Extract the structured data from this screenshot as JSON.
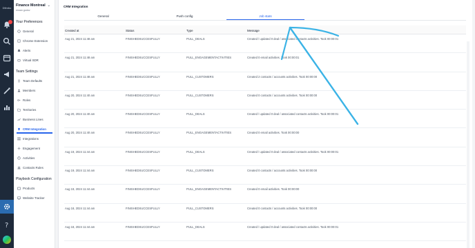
{
  "rail": {
    "logo": "Dfimbo",
    "icons": [
      "bell-icon",
      "search-icon",
      "calendar-icon",
      "megaphone-icon",
      "wand-icon",
      "chart-icon",
      "gear-icon",
      "help-icon"
    ]
  },
  "sidebar": {
    "company": "Finance Montreal",
    "user": "erwan godov",
    "preferences_title": "Your Preferences",
    "preferences": [
      {
        "label": "General",
        "icon": "gear-icon"
      },
      {
        "label": "Chrome Extension",
        "icon": "puzzle-icon"
      },
      {
        "label": "Alerts",
        "icon": "bell-icon"
      },
      {
        "label": "Virtual SDR",
        "icon": "robot-icon"
      }
    ],
    "team_title": "Team Settings",
    "team": [
      {
        "label": "Team Defaults",
        "icon": "sliders-icon"
      },
      {
        "label": "Members",
        "icon": "user-icon"
      },
      {
        "label": "Roles",
        "icon": "key-icon"
      },
      {
        "label": "Territories",
        "icon": "folder-icon"
      },
      {
        "label": "Business Lines",
        "icon": "trend-icon"
      },
      {
        "label": "CRM Integration",
        "icon": "pin-icon"
      },
      {
        "label": "Integrations",
        "icon": "grid-icon"
      },
      {
        "label": "Engagement",
        "icon": "engage-icon"
      },
      {
        "label": "Activities",
        "icon": "clock-icon"
      },
      {
        "label": "Contacts Rules",
        "icon": "contacts-icon"
      }
    ],
    "playbook_title": "Playbook Configuration",
    "playbook": [
      {
        "label": "Products",
        "icon": "box-icon"
      },
      {
        "label": "Website Tracker",
        "icon": "monitor-icon"
      }
    ]
  },
  "main": {
    "title": "CRM Integration",
    "tabs": [
      "General",
      "Push config",
      "Job stats"
    ],
    "active_tab": "Job stats",
    "columns": [
      "Created at",
      "Status",
      "Type",
      "Message"
    ],
    "rows": [
      [
        "Aug 21, 2024 11:48 am",
        "FINISHEDSUCCESFULLY",
        "PULL_DEALS",
        "Created / updated 0 deal / associated contacts activities. Took 00:00:01"
      ],
      [
        "Aug 21, 2024 11:48 am",
        "FINISHEDSUCCESFULLY",
        "PULL_ENGAGEMENTACTIVITIES",
        "Created 0 email activities. Took 00:00:01"
      ],
      [
        "Aug 21, 2024 11:48 am",
        "FINISHEDSUCCESFULLY",
        "PULL_CUSTOMERS",
        "Created 2 contacts / accounts activities. Took 00:00:00"
      ],
      [
        "Aug 20, 2024 11:40 am",
        "FINISHEDSUCCESFULLY",
        "PULL_CUSTOMERS",
        "Created 0 contacts / accounts activities. Took 00:00:00"
      ],
      [
        "Aug 20, 2024 11:40 am",
        "FINISHEDSUCCESFULLY",
        "PULL_DEALS",
        "Created / updated 0 deal / associated contacts activities. Took 00:00:01"
      ],
      [
        "Aug 20, 2024 11:40 am",
        "FINISHEDSUCCESFULLY",
        "PULL_ENGAGEMENTACTIVITIES",
        "Created 0 email activities. Took 00:00:00"
      ],
      [
        "Aug 19, 2024 11:44 am",
        "FINISHEDSUCCESFULLY",
        "PULL_DEALS",
        "Created / updated 0 deal / associated contacts activities. Took 00:00:01"
      ],
      [
        "Aug 19, 2024 11:44 am",
        "FINISHEDSUCCESFULLY",
        "PULL_CUSTOMERS",
        "Created 0 contacts / accounts activities. Took 00:00:00"
      ],
      [
        "Aug 19, 2024 11:44 am",
        "FINISHEDSUCCESFULLY",
        "PULL_ENGAGEMENTACTIVITIES",
        "Created 0 email activities. Took 00:00:00"
      ],
      [
        "Aug 18, 2024 11:44 am",
        "FINISHEDSUCCESFULLY",
        "PULL_CUSTOMERS",
        "Created 0 contacts / accounts activities. Took 00:00:00"
      ],
      [
        "Aug 18, 2024 11:44 am",
        "FINISHEDSUCCESFULLY",
        "PULL_DEALS",
        "Created / updated 0 deal / associated contacts activities. Took 00:00:01"
      ]
    ]
  },
  "colors": {
    "accent": "#2563eb",
    "rail": "#1e2a3a",
    "annotation": "#3bb3e6"
  }
}
